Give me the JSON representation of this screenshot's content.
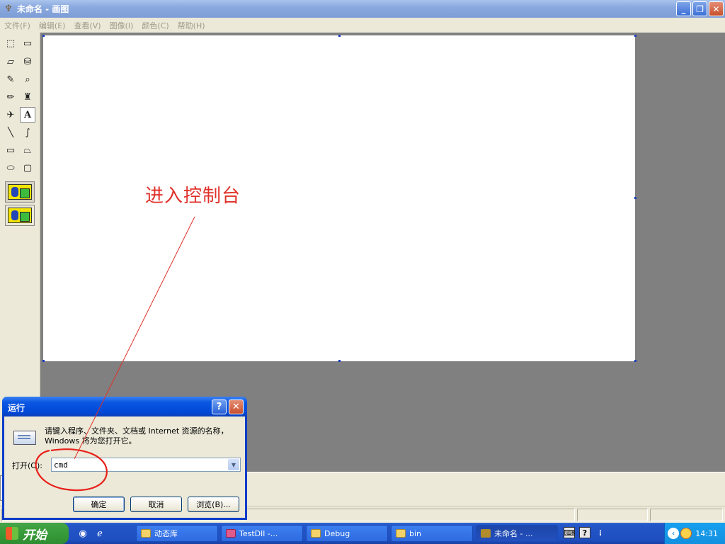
{
  "window": {
    "title": "未命名 - 画图",
    "icon": "paint-brush-icon"
  },
  "menu": {
    "items": [
      "文件(F)",
      "编辑(E)",
      "查看(V)",
      "图像(I)",
      "颜色(C)",
      "帮助(H)"
    ]
  },
  "toolbox": {
    "tools": [
      {
        "name": "free-select",
        "glyph": "⬚"
      },
      {
        "name": "rect-select",
        "glyph": "▭"
      },
      {
        "name": "eraser",
        "glyph": "▱"
      },
      {
        "name": "fill",
        "glyph": "⛁"
      },
      {
        "name": "color-picker",
        "glyph": "✎"
      },
      {
        "name": "magnifier",
        "glyph": "⌕"
      },
      {
        "name": "pencil",
        "glyph": "✏"
      },
      {
        "name": "brush",
        "glyph": "♜"
      },
      {
        "name": "airbrush",
        "glyph": "✈"
      },
      {
        "name": "text",
        "glyph": "A"
      },
      {
        "name": "line",
        "glyph": "╲"
      },
      {
        "name": "curve",
        "glyph": "∫"
      },
      {
        "name": "rectangle",
        "glyph": "▭"
      },
      {
        "name": "polygon",
        "glyph": "⏢"
      },
      {
        "name": "ellipse",
        "glyph": "⬭"
      },
      {
        "name": "rounded-rect",
        "glyph": "▢"
      }
    ],
    "active_tool": "text"
  },
  "canvas": {
    "annotation_text": "进入控制台",
    "annotation_color": "#e0302a"
  },
  "run_dialog": {
    "title": "运行",
    "description": "请键入程序、文件夹、文档或 Internet 资源的名称，Windows 将为您打开它。",
    "open_label": "打开(O):",
    "open_value": "cmd",
    "ok_label": "确定",
    "cancel_label": "取消",
    "browse_label": "浏览(B)..."
  },
  "taskbar": {
    "start_label": "开始",
    "tasks": [
      "动态库",
      "TestDll -...",
      "Debug",
      "bin",
      "未命名 - ..."
    ],
    "active_task": 4,
    "clock": "14:31"
  }
}
